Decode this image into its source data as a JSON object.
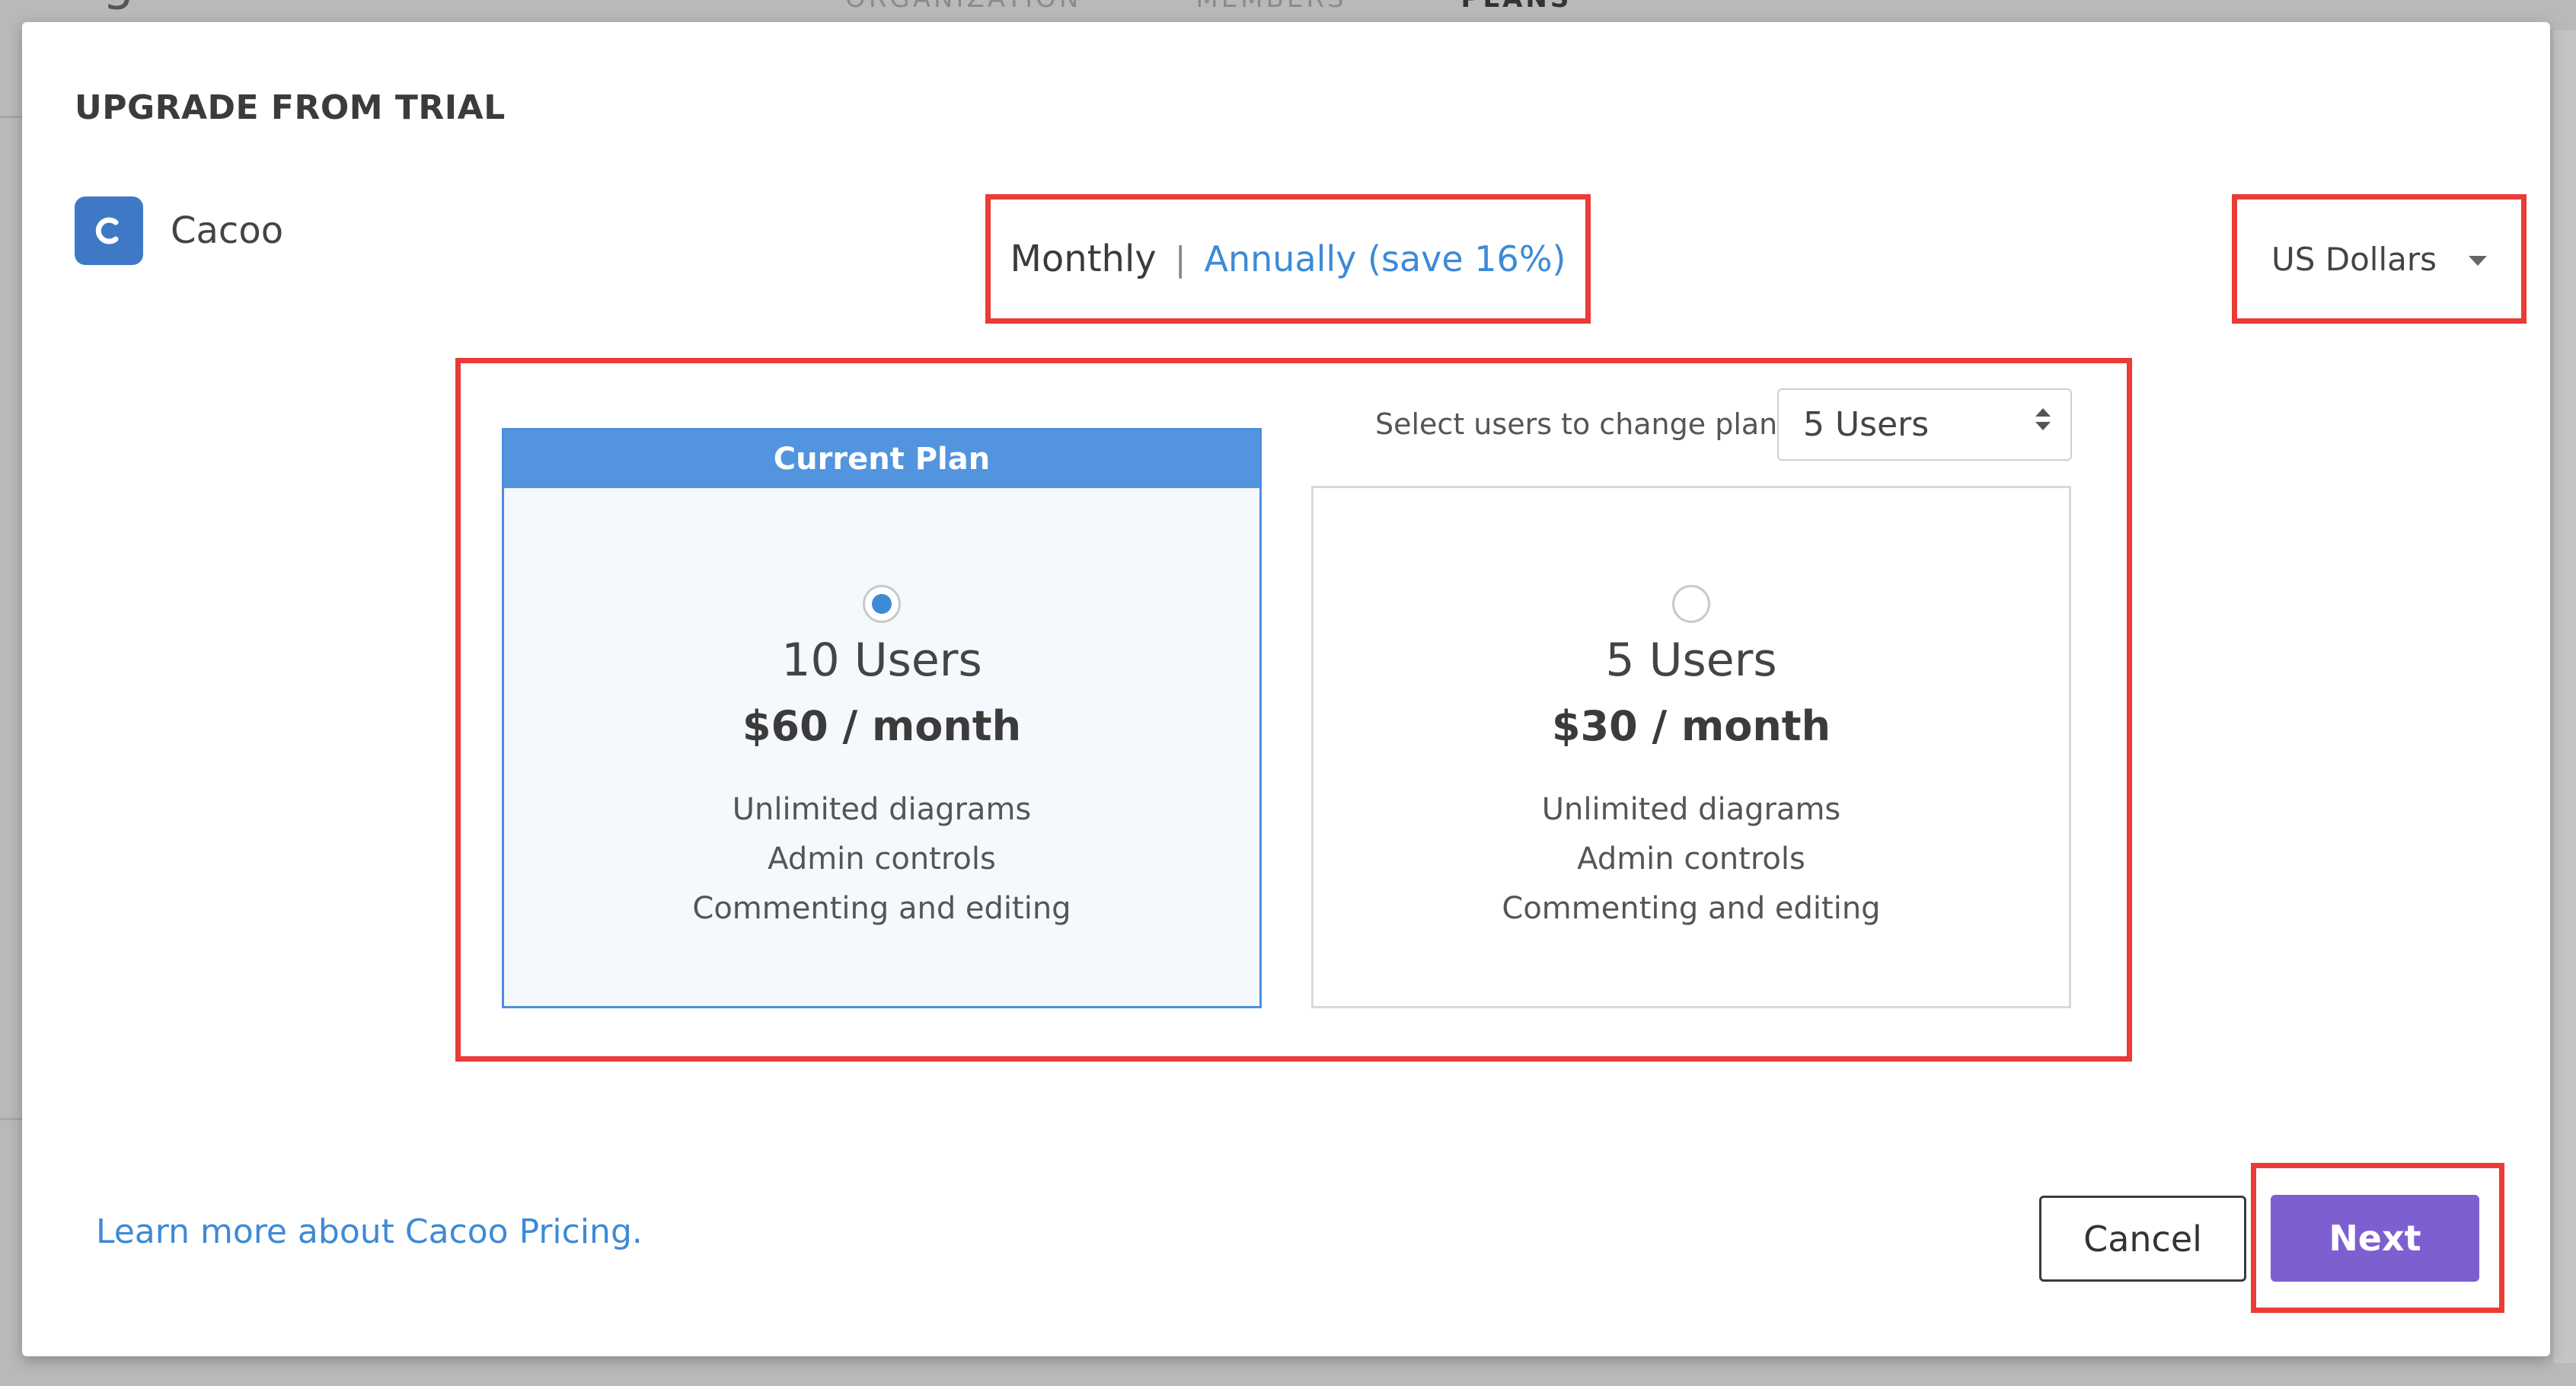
{
  "background": {
    "page_title": "Settings",
    "tabs": [
      "ORGANIZATION",
      "MEMBERS",
      "PLANS"
    ]
  },
  "modal": {
    "title": "UPGRADE FROM TRIAL",
    "brand": {
      "logo_letter": "C",
      "name": "Cacoo"
    },
    "billing": {
      "monthly": "Monthly",
      "separator": "|",
      "annually": "Annually (save 16%)"
    },
    "currency": {
      "selected": "US Dollars",
      "icon": "chevron-down-icon"
    },
    "users_selector": {
      "label": "Select users to change plan",
      "value": "5 Users"
    },
    "plans": [
      {
        "header": "Current Plan",
        "users": "10 Users",
        "price": "$60 / month",
        "features": [
          "Unlimited diagrams",
          "Admin controls",
          "Commenting and editing"
        ],
        "selected": true
      },
      {
        "users": "5 Users",
        "price": "$30 / month",
        "features": [
          "Unlimited diagrams",
          "Admin controls",
          "Commenting and editing"
        ],
        "selected": false
      }
    ],
    "footer": {
      "learn_more": "Learn more about Cacoo Pricing.",
      "cancel": "Cancel",
      "next": "Next"
    }
  },
  "colors": {
    "accent_blue": "#3d8ad7",
    "header_blue": "#5294de",
    "next_purple": "#7e5fd0",
    "annotation_red": "#ea3b36"
  }
}
